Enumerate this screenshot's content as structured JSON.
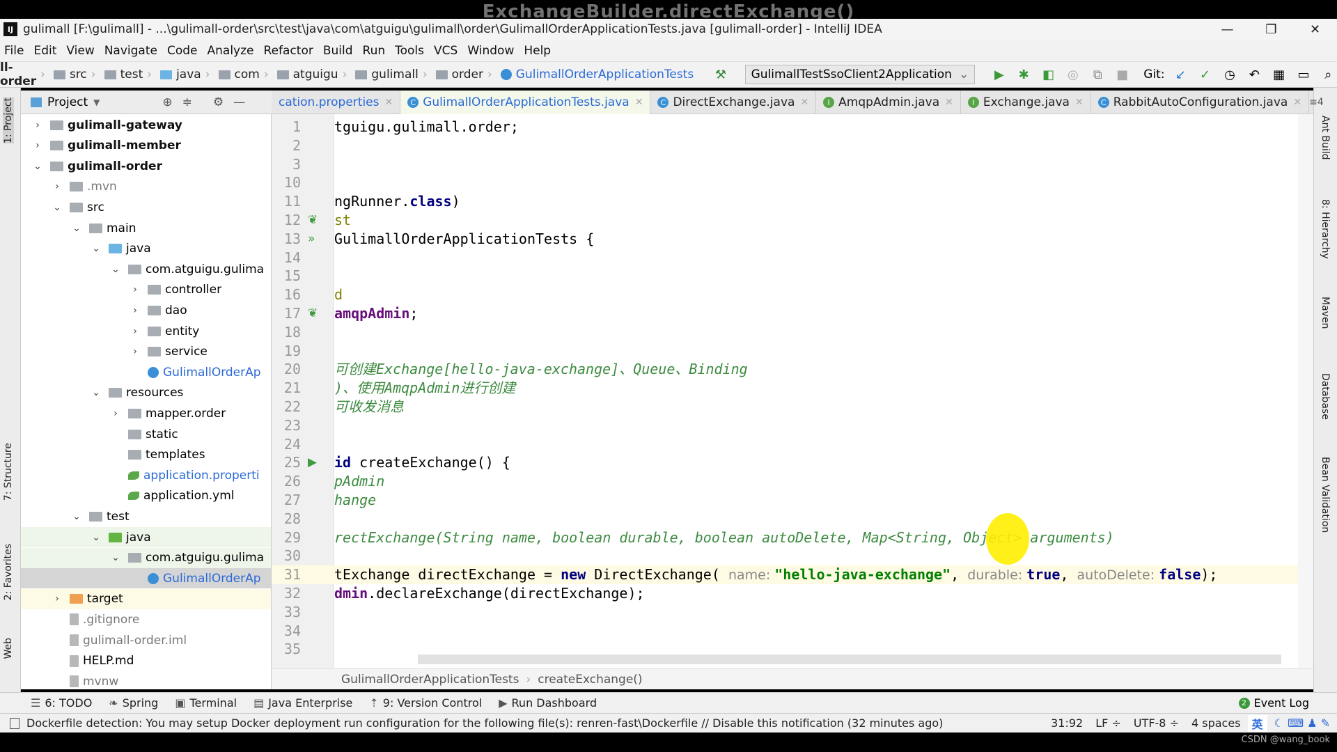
{
  "overlay": {
    "watermark": "ExchangeBuilder.directExchange()",
    "credit": "CSDN @wang_book"
  },
  "window": {
    "title": "gulimall [F:\\gulimall] - ...\\gulimall-order\\src\\test\\java\\com\\atguigu\\gulimall\\order\\GulimallOrderApplicationTests.java [gulimall-order] - IntelliJ IDEA",
    "logo": "IJ",
    "minimize": "—",
    "restore": "❐",
    "close": "✕"
  },
  "menu": [
    "File",
    "Edit",
    "View",
    "Navigate",
    "Code",
    "Analyze",
    "Refactor",
    "Build",
    "Run",
    "Tools",
    "VCS",
    "Window",
    "Help"
  ],
  "nav": {
    "crumbs": [
      "ll-order",
      "src",
      "test",
      "java",
      "com",
      "atguigu",
      "gulimall",
      "order",
      "GulimallOrderApplicationTests"
    ],
    "run_config": "GulimallTestSsoClient2Application",
    "git_label": "Git:"
  },
  "project": {
    "header": "Project",
    "tree": [
      {
        "label": "gulimall-gateway",
        "level": 0,
        "chev": "›",
        "bold": true
      },
      {
        "label": "gulimall-member",
        "level": 0,
        "chev": "›",
        "bold": true
      },
      {
        "label": "gulimall-order",
        "level": 0,
        "chev": "⌄",
        "bold": true
      },
      {
        "label": ".mvn",
        "level": 1,
        "chev": "›",
        "muted": true
      },
      {
        "label": "src",
        "level": 1,
        "chev": "⌄"
      },
      {
        "label": "main",
        "level": 2,
        "chev": "⌄"
      },
      {
        "label": "java",
        "level": 3,
        "chev": "⌄",
        "color": "#6cb4e4"
      },
      {
        "label": "com.atguigu.gulima",
        "level": 4,
        "chev": "⌄"
      },
      {
        "label": "controller",
        "level": 5,
        "chev": "›"
      },
      {
        "label": "dao",
        "level": 5,
        "chev": "›"
      },
      {
        "label": "entity",
        "level": 5,
        "chev": "›"
      },
      {
        "label": "service",
        "level": 5,
        "chev": "›"
      },
      {
        "label": "GulimallOrderAp",
        "level": 5,
        "chev": "",
        "cls": true
      },
      {
        "label": "resources",
        "level": 3,
        "chev": "⌄"
      },
      {
        "label": "mapper.order",
        "level": 4,
        "chev": "›"
      },
      {
        "label": "static",
        "level": 4,
        "chev": ""
      },
      {
        "label": "templates",
        "level": 4,
        "chev": ""
      },
      {
        "label": "application.properti",
        "level": 4,
        "chev": "",
        "spring": true,
        "blue": true
      },
      {
        "label": "application.yml",
        "level": 4,
        "chev": "",
        "spring": true
      },
      {
        "label": "test",
        "level": 2,
        "chev": "⌄"
      },
      {
        "label": "java",
        "level": 3,
        "chev": "⌄",
        "color": "#62b543",
        "bg": "#eef6ea"
      },
      {
        "label": "com.atguigu.gulima",
        "level": 4,
        "chev": "⌄",
        "bg": "#eef6ea"
      },
      {
        "label": "GulimallOrderAp",
        "level": 5,
        "chev": "",
        "cls": true,
        "bg": "#d5d5d5"
      },
      {
        "label": "target",
        "level": 1,
        "chev": "›",
        "color": "#f0a050",
        "bg": "#fdfbe6"
      },
      {
        "label": ".gitignore",
        "level": 1,
        "chev": "",
        "file": true,
        "muted": true
      },
      {
        "label": "gulimall-order.iml",
        "level": 1,
        "chev": "",
        "file": true,
        "muted": true
      },
      {
        "label": "HELP.md",
        "level": 1,
        "chev": "",
        "file": true
      },
      {
        "label": "mvnw",
        "level": 1,
        "chev": "",
        "file": true,
        "muted": true
      }
    ]
  },
  "tabs": [
    {
      "label": "cation.properties",
      "icon": "",
      "active": false,
      "blue": true
    },
    {
      "label": "GulimallOrderApplicationTests.java",
      "icon": "C",
      "active": true
    },
    {
      "label": "DirectExchange.java",
      "icon": "C"
    },
    {
      "label": "AmqpAdmin.java",
      "icon": "I"
    },
    {
      "label": "Exchange.java",
      "icon": "I"
    },
    {
      "label": "RabbitAutoConfiguration.java",
      "icon": "C"
    }
  ],
  "tabs_overflow": "≡4",
  "editor": {
    "lines": [
      {
        "n": "1",
        "segs": [
          [
            "",
            "tguigu.gulimall.order;"
          ]
        ]
      },
      {
        "n": "2",
        "segs": []
      },
      {
        "n": "3",
        "segs": []
      },
      {
        "n": "10",
        "segs": []
      },
      {
        "n": "11",
        "segs": [
          [
            "",
            "ngRunner."
          ],
          [
            "kw",
            "class"
          ],
          [
            "",
            ")"
          ]
        ]
      },
      {
        "n": "12",
        "segs": [
          [
            "ann",
            "st"
          ]
        ],
        "gicon": "spring"
      },
      {
        "n": "13",
        "segs": [
          [
            "",
            "GulimallOrderApplicationTests {"
          ]
        ],
        "gicon": "run2"
      },
      {
        "n": "14",
        "segs": []
      },
      {
        "n": "15",
        "segs": []
      },
      {
        "n": "16",
        "segs": [
          [
            "ann",
            "d"
          ]
        ]
      },
      {
        "n": "17",
        "segs": [
          [
            "field",
            "amqpAdmin"
          ],
          [
            "",
            ";"
          ]
        ],
        "gicon": "spring"
      },
      {
        "n": "18",
        "segs": []
      },
      {
        "n": "19",
        "segs": []
      },
      {
        "n": "20",
        "segs": [
          [
            "cmt",
            "可创建Exchange[hello-java-exchange]、Queue、Binding"
          ]
        ]
      },
      {
        "n": "21",
        "segs": [
          [
            "cmt",
            ")、使用AmqpAdmin进行创建"
          ]
        ]
      },
      {
        "n": "22",
        "segs": [
          [
            "cmt",
            "可收发消息"
          ]
        ]
      },
      {
        "n": "23",
        "segs": []
      },
      {
        "n": "24",
        "segs": []
      },
      {
        "n": "25",
        "segs": [
          [
            "kw",
            "id"
          ],
          [
            "",
            " createExchange() {"
          ]
        ],
        "gicon": "run"
      },
      {
        "n": "26",
        "segs": [
          [
            "cmt",
            "pAdmin"
          ]
        ]
      },
      {
        "n": "27",
        "segs": [
          [
            "cmt",
            "hange"
          ]
        ]
      },
      {
        "n": "28",
        "segs": []
      },
      {
        "n": "29",
        "segs": [
          [
            "cmt",
            "rectExchange(String name, boolean durable, boolean autoDelete, Map<String, Object> arguments)"
          ]
        ]
      },
      {
        "n": "30",
        "segs": []
      },
      {
        "n": "31",
        "segs": [
          [
            "",
            "tExchange directExchange = "
          ],
          [
            "kw",
            "new"
          ],
          [
            "",
            " DirectExchange( "
          ],
          [
            "hint",
            "name: "
          ],
          [
            "str",
            "\"hello-java-exchange\""
          ],
          [
            "",
            ", "
          ],
          [
            "hint",
            "durable: "
          ],
          [
            "kw",
            "true"
          ],
          [
            "",
            ", "
          ],
          [
            "hint",
            "autoDelete: "
          ],
          [
            "kw",
            "false"
          ],
          [
            "",
            ");"
          ]
        ],
        "current": true
      },
      {
        "n": "32",
        "segs": [
          [
            "field",
            "dmin"
          ],
          [
            "",
            ".declareExchange(directExchange);"
          ]
        ]
      },
      {
        "n": "33",
        "segs": []
      },
      {
        "n": "34",
        "segs": []
      },
      {
        "n": "35",
        "segs": []
      }
    ]
  },
  "breadcrumb": [
    "GulimallOrderApplicationTests",
    "createExchange()"
  ],
  "toolwindows": [
    {
      "label": "6: TODO",
      "icon": "☰"
    },
    {
      "label": "Spring",
      "icon": "❧"
    },
    {
      "label": "Terminal",
      "icon": "▣"
    },
    {
      "label": "Java Enterprise",
      "icon": "▤"
    },
    {
      "label": "9: Version Control",
      "icon": "⇡"
    },
    {
      "label": "Run Dashboard",
      "icon": "▶"
    }
  ],
  "event_log": "Event Log",
  "status": {
    "message": "Dockerfile detection: You may setup Docker deployment run configuration for the following file(s): renren-fast\\Dockerfile // Disable this notification (32 minutes ago)",
    "position": "31:92",
    "line_sep": "LF ÷",
    "encoding": "UTF-8 ÷",
    "indent": "4 spaces",
    "ime": "英"
  },
  "side_left": [
    "1: Project",
    "7: Structure",
    "2: Favorites",
    "Web"
  ],
  "side_right": [
    "Ant Build",
    "8: Hierarchy",
    "Maven",
    "Database",
    "Bean Validation"
  ],
  "colors": {
    "keyword": "#000080",
    "string": "#008000",
    "comment": "#3d8b40",
    "field": "#660e7a",
    "run": "#3f9b3f"
  }
}
